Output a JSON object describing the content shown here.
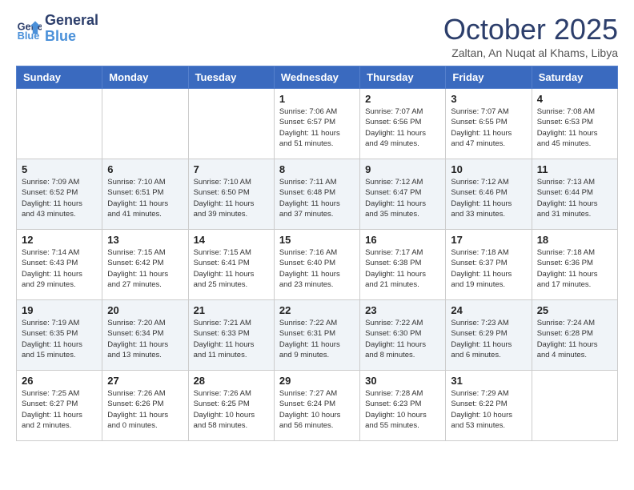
{
  "header": {
    "logo_line1": "General",
    "logo_line2": "Blue",
    "month": "October 2025",
    "location": "Zaltan, An Nuqat al Khams, Libya"
  },
  "weekdays": [
    "Sunday",
    "Monday",
    "Tuesday",
    "Wednesday",
    "Thursday",
    "Friday",
    "Saturday"
  ],
  "weeks": [
    [
      {
        "day": "",
        "info": ""
      },
      {
        "day": "",
        "info": ""
      },
      {
        "day": "",
        "info": ""
      },
      {
        "day": "1",
        "info": "Sunrise: 7:06 AM\nSunset: 6:57 PM\nDaylight: 11 hours\nand 51 minutes."
      },
      {
        "day": "2",
        "info": "Sunrise: 7:07 AM\nSunset: 6:56 PM\nDaylight: 11 hours\nand 49 minutes."
      },
      {
        "day": "3",
        "info": "Sunrise: 7:07 AM\nSunset: 6:55 PM\nDaylight: 11 hours\nand 47 minutes."
      },
      {
        "day": "4",
        "info": "Sunrise: 7:08 AM\nSunset: 6:53 PM\nDaylight: 11 hours\nand 45 minutes."
      }
    ],
    [
      {
        "day": "5",
        "info": "Sunrise: 7:09 AM\nSunset: 6:52 PM\nDaylight: 11 hours\nand 43 minutes."
      },
      {
        "day": "6",
        "info": "Sunrise: 7:10 AM\nSunset: 6:51 PM\nDaylight: 11 hours\nand 41 minutes."
      },
      {
        "day": "7",
        "info": "Sunrise: 7:10 AM\nSunset: 6:50 PM\nDaylight: 11 hours\nand 39 minutes."
      },
      {
        "day": "8",
        "info": "Sunrise: 7:11 AM\nSunset: 6:48 PM\nDaylight: 11 hours\nand 37 minutes."
      },
      {
        "day": "9",
        "info": "Sunrise: 7:12 AM\nSunset: 6:47 PM\nDaylight: 11 hours\nand 35 minutes."
      },
      {
        "day": "10",
        "info": "Sunrise: 7:12 AM\nSunset: 6:46 PM\nDaylight: 11 hours\nand 33 minutes."
      },
      {
        "day": "11",
        "info": "Sunrise: 7:13 AM\nSunset: 6:44 PM\nDaylight: 11 hours\nand 31 minutes."
      }
    ],
    [
      {
        "day": "12",
        "info": "Sunrise: 7:14 AM\nSunset: 6:43 PM\nDaylight: 11 hours\nand 29 minutes."
      },
      {
        "day": "13",
        "info": "Sunrise: 7:15 AM\nSunset: 6:42 PM\nDaylight: 11 hours\nand 27 minutes."
      },
      {
        "day": "14",
        "info": "Sunrise: 7:15 AM\nSunset: 6:41 PM\nDaylight: 11 hours\nand 25 minutes."
      },
      {
        "day": "15",
        "info": "Sunrise: 7:16 AM\nSunset: 6:40 PM\nDaylight: 11 hours\nand 23 minutes."
      },
      {
        "day": "16",
        "info": "Sunrise: 7:17 AM\nSunset: 6:38 PM\nDaylight: 11 hours\nand 21 minutes."
      },
      {
        "day": "17",
        "info": "Sunrise: 7:18 AM\nSunset: 6:37 PM\nDaylight: 11 hours\nand 19 minutes."
      },
      {
        "day": "18",
        "info": "Sunrise: 7:18 AM\nSunset: 6:36 PM\nDaylight: 11 hours\nand 17 minutes."
      }
    ],
    [
      {
        "day": "19",
        "info": "Sunrise: 7:19 AM\nSunset: 6:35 PM\nDaylight: 11 hours\nand 15 minutes."
      },
      {
        "day": "20",
        "info": "Sunrise: 7:20 AM\nSunset: 6:34 PM\nDaylight: 11 hours\nand 13 minutes."
      },
      {
        "day": "21",
        "info": "Sunrise: 7:21 AM\nSunset: 6:33 PM\nDaylight: 11 hours\nand 11 minutes."
      },
      {
        "day": "22",
        "info": "Sunrise: 7:22 AM\nSunset: 6:31 PM\nDaylight: 11 hours\nand 9 minutes."
      },
      {
        "day": "23",
        "info": "Sunrise: 7:22 AM\nSunset: 6:30 PM\nDaylight: 11 hours\nand 8 minutes."
      },
      {
        "day": "24",
        "info": "Sunrise: 7:23 AM\nSunset: 6:29 PM\nDaylight: 11 hours\nand 6 minutes."
      },
      {
        "day": "25",
        "info": "Sunrise: 7:24 AM\nSunset: 6:28 PM\nDaylight: 11 hours\nand 4 minutes."
      }
    ],
    [
      {
        "day": "26",
        "info": "Sunrise: 7:25 AM\nSunset: 6:27 PM\nDaylight: 11 hours\nand 2 minutes."
      },
      {
        "day": "27",
        "info": "Sunrise: 7:26 AM\nSunset: 6:26 PM\nDaylight: 11 hours\nand 0 minutes."
      },
      {
        "day": "28",
        "info": "Sunrise: 7:26 AM\nSunset: 6:25 PM\nDaylight: 10 hours\nand 58 minutes."
      },
      {
        "day": "29",
        "info": "Sunrise: 7:27 AM\nSunset: 6:24 PM\nDaylight: 10 hours\nand 56 minutes."
      },
      {
        "day": "30",
        "info": "Sunrise: 7:28 AM\nSunset: 6:23 PM\nDaylight: 10 hours\nand 55 minutes."
      },
      {
        "day": "31",
        "info": "Sunrise: 7:29 AM\nSunset: 6:22 PM\nDaylight: 10 hours\nand 53 minutes."
      },
      {
        "day": "",
        "info": ""
      }
    ]
  ]
}
